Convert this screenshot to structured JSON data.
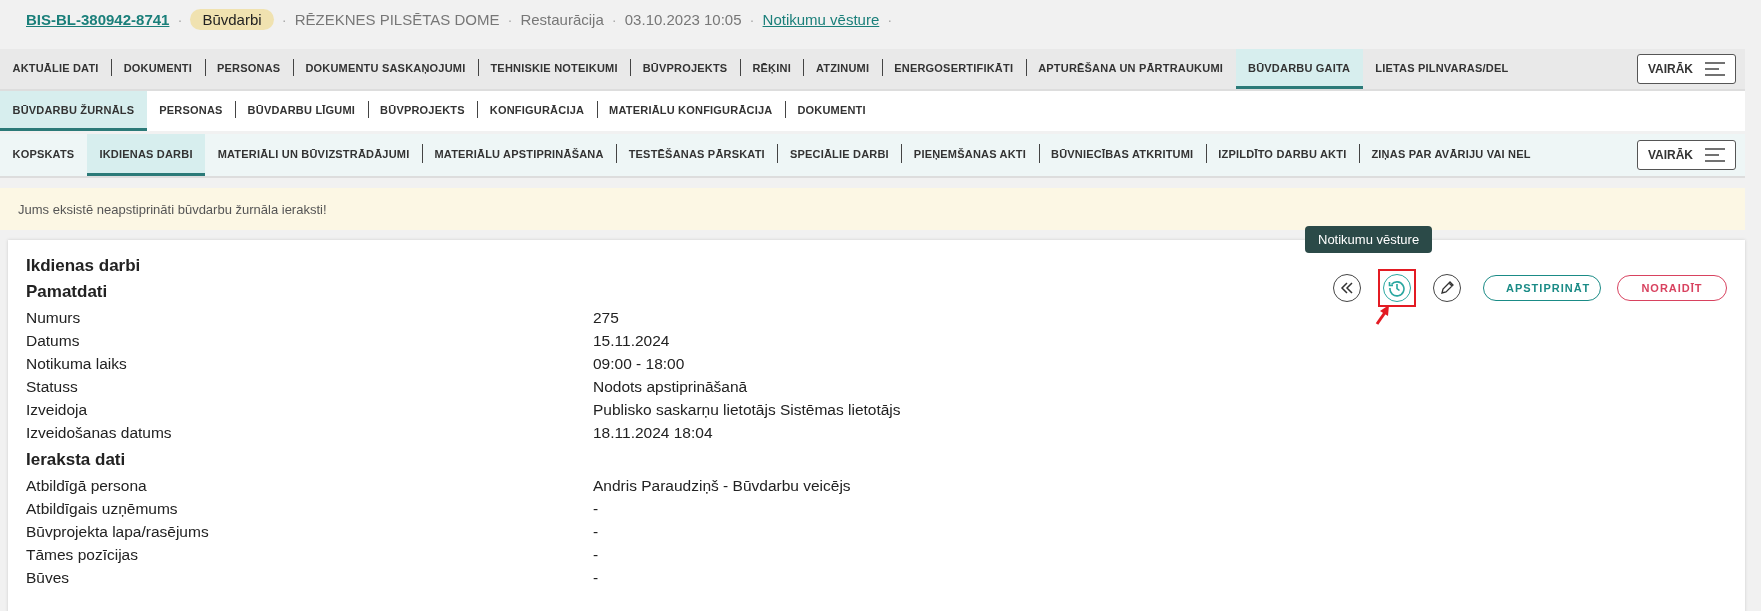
{
  "header": {
    "id_link": "BIS-BL-380942-8741",
    "badge": "Būvdarbi",
    "items": [
      "RĒZEKNES PILSĒTAS DOME",
      "Restaurācija",
      "03.10.2023 10:05"
    ],
    "history_link": "Notikumu vēsture",
    "separator": "·"
  },
  "main_tabs": [
    {
      "label": "AKTUĀLIE DATI",
      "selected": false
    },
    {
      "label": "DOKUMENTI",
      "selected": false
    },
    {
      "label": "PERSONAS",
      "selected": false
    },
    {
      "label": "DOKUMENTU SASKAŅOJUMI",
      "selected": false
    },
    {
      "label": "TEHNISKIE NOTEIKUMI",
      "selected": false
    },
    {
      "label": "BŪVPROJEKTS",
      "selected": false
    },
    {
      "label": "RĒĶINI",
      "selected": false
    },
    {
      "label": "ATZINUMI",
      "selected": false
    },
    {
      "label": "ENERGOSERTIFIKĀTI",
      "selected": false
    },
    {
      "label": "APTURĒŠANA UN PĀRTRAUKUMI",
      "selected": false
    },
    {
      "label": "BŪVDARBU GAITA",
      "selected": true
    },
    {
      "label": "LIETAS PILNVARAS/DEL",
      "selected": false
    }
  ],
  "main_more": "VAIRĀK",
  "sub_tabs": [
    {
      "label": "BŪVDARBU ŽURNĀLS",
      "selected": true
    },
    {
      "label": "PERSONAS",
      "selected": false
    },
    {
      "label": "BŪVDARBU LĪGUMI",
      "selected": false
    },
    {
      "label": "BŪVPROJEKTS",
      "selected": false
    },
    {
      "label": "KONFIGURĀCIJA",
      "selected": false
    },
    {
      "label": "MATERIĀLU KONFIGURĀCIJA",
      "selected": false
    },
    {
      "label": "DOKUMENTI",
      "selected": false
    }
  ],
  "journal_tabs": [
    {
      "label": "KOPSKATS",
      "selected": false
    },
    {
      "label": "IKDIENAS DARBI",
      "selected": true
    },
    {
      "label": "MATERIĀLI UN BŪVIZSTRĀDĀJUMI",
      "selected": false
    },
    {
      "label": "MATERIĀLU APSTIPRINĀŠANA",
      "selected": false
    },
    {
      "label": "TESTĒŠANAS PĀRSKATI",
      "selected": false
    },
    {
      "label": "SPECIĀLIE DARBI",
      "selected": false
    },
    {
      "label": "PIEŅEMŠANAS AKTI",
      "selected": false
    },
    {
      "label": "BŪVNIECĪBAS ATKRITUMI",
      "selected": false
    },
    {
      "label": "IZPILDĪTO DARBU AKTI",
      "selected": false
    },
    {
      "label": "ZIŅAS PAR AVĀRIJU VAI NEL",
      "selected": false
    }
  ],
  "journal_more": "VAIRĀK",
  "warning": "Jums eksistē neapstiprināti būvdarbu žurnāla ieraksti!",
  "record": {
    "title": "Ikdienas darbi",
    "tooltip": "Notikumu vēsture",
    "approve_button": "APSTIPRINĀT",
    "reject_button": "NORAIDĪT",
    "sections": [
      {
        "heading": "Pamatdati",
        "fields": [
          {
            "label": "Numurs",
            "value": "275"
          },
          {
            "label": "Datums",
            "value": "15.11.2024"
          },
          {
            "label": "Notikuma laiks",
            "value": "09:00 - 18:00"
          },
          {
            "label": "Statuss",
            "value": "Nodots apstiprināšanā"
          },
          {
            "label": "Izveidoja",
            "value": "Publisko saskarņu lietotājs Sistēmas lietotājs"
          },
          {
            "label": "Izveidošanas datums",
            "value": "18.11.2024 18:04"
          }
        ]
      },
      {
        "heading": "Ieraksta dati",
        "fields": [
          {
            "label": "Atbildīgā persona",
            "value": "Andris Paraudziņš - Būvdarbu veicējs"
          },
          {
            "label": "Atbildīgais uzņēmums",
            "value": "-"
          },
          {
            "label": "Būvprojekta lapa/rasējums",
            "value": "-"
          },
          {
            "label": "Tāmes pozīcijas",
            "value": "-"
          },
          {
            "label": "Būves",
            "value": "-"
          }
        ]
      }
    ]
  }
}
